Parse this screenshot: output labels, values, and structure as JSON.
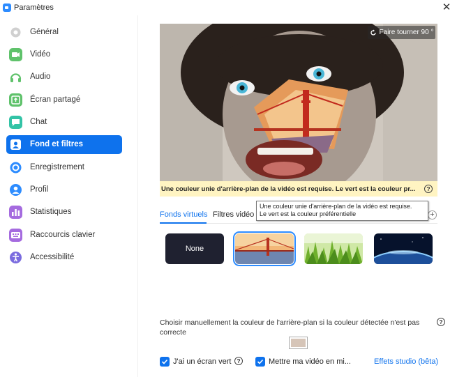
{
  "window": {
    "title": "Paramètres",
    "close_symbol": "✕"
  },
  "sidebar": {
    "items": [
      {
        "label": "Général",
        "icon": "gear-icon",
        "color": "#d0d0d0"
      },
      {
        "label": "Vidéo",
        "icon": "video-camera-icon",
        "color": "#5fc26b"
      },
      {
        "label": "Audio",
        "icon": "headphones-icon",
        "color": "#5fc26b"
      },
      {
        "label": "Écran partagé",
        "icon": "share-screen-icon",
        "color": "#5fc26b"
      },
      {
        "label": "Chat",
        "icon": "chat-bubble-icon",
        "color": "#33c3a6"
      },
      {
        "label": "Fond et filtres",
        "icon": "person-background-icon",
        "color": "#ffffff"
      },
      {
        "label": "Enregistrement",
        "icon": "record-icon",
        "color": "#2d8cff"
      },
      {
        "label": "Profil",
        "icon": "profile-icon",
        "color": "#2d8cff"
      },
      {
        "label": "Statistiques",
        "icon": "statistics-icon",
        "color": "#a56bdf"
      },
      {
        "label": "Raccourcis clavier",
        "icon": "keyboard-icon",
        "color": "#a56bdf"
      },
      {
        "label": "Accessibilité",
        "icon": "accessibility-icon",
        "color": "#7a6bdf"
      }
    ],
    "active_index": 5
  },
  "preview": {
    "rotate_label": "Faire tourner 90 °",
    "warning": "Une couleur unie d'arrière-plan de la vidéo est requise. Le vert est la couleur pr..."
  },
  "tabs": [
    {
      "label": "Fonds virtuels",
      "active": true
    },
    {
      "label": "Filtres vidéo",
      "active": false
    }
  ],
  "tooltip": {
    "line1": "Une couleur unie d'arrière-plan de la vidéo est requise.",
    "line2": "Le vert est la couleur préférentielle"
  },
  "backgrounds": [
    {
      "label": "None",
      "kind": "none",
      "selected": false
    },
    {
      "kind": "golden-gate-bridge",
      "selected": true
    },
    {
      "kind": "grass",
      "selected": false
    },
    {
      "kind": "earth-from-space",
      "selected": false
    }
  ],
  "manual_color": {
    "text": "Choisir manuellement la couleur de l'arrière-plan si la couleur détectée n'est pas correcte",
    "swatch_color": "#d6c5b8"
  },
  "options": {
    "green_screen_label": "J'ai un écran vert",
    "green_screen_checked": true,
    "mirror_label": "Mettre ma vidéo en mi...",
    "mirror_checked": true,
    "studio_effects_label": "Effets studio (bêta)"
  },
  "help_symbol": "?",
  "add_symbol": "+",
  "accent": "#0e72ed"
}
